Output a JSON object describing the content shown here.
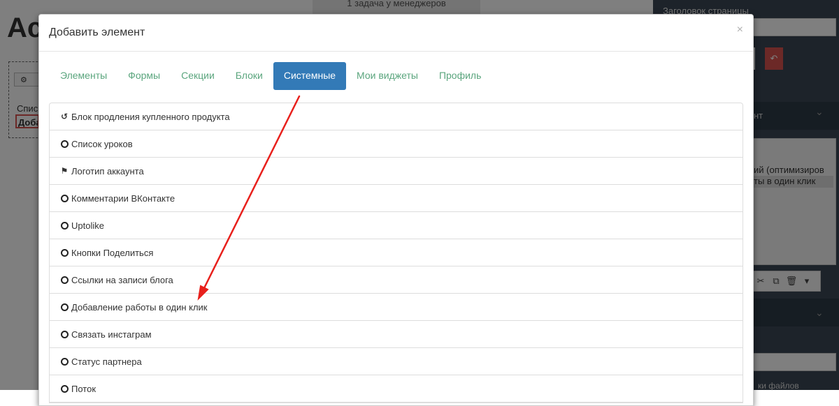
{
  "background": {
    "page_title": "Ac",
    "topbar_text": "1 задача у менеджеров",
    "left_text1": "Спис",
    "left_text2": "Доба",
    "right_label": "Заголовок страницы",
    "right_section_label": "нт",
    "panel_line1": "ий (оптимизиров",
    "panel_line2": "ты в один клик",
    "footer_text": "ки файлов",
    "undo_icon": "↶"
  },
  "modal": {
    "title": "Добавить элемент",
    "close_label": "×",
    "tabs": [
      {
        "label": "Элементы",
        "active": false
      },
      {
        "label": "Формы",
        "active": false
      },
      {
        "label": "Секции",
        "active": false
      },
      {
        "label": "Блоки",
        "active": false
      },
      {
        "label": "Системные",
        "active": true
      },
      {
        "label": "Мои виджеты",
        "active": false
      },
      {
        "label": "Профиль",
        "active": false
      }
    ],
    "items": [
      {
        "label": "Блок продления купленного продукта",
        "icon": "history-icon"
      },
      {
        "label": "Список уроков",
        "icon": "circle-icon"
      },
      {
        "label": "Логотип аккаунта",
        "icon": "flag-icon"
      },
      {
        "label": "Комментарии ВКонтакте",
        "icon": "circle-icon"
      },
      {
        "label": "Uptolike",
        "icon": "circle-icon"
      },
      {
        "label": "Кнопки Поделиться",
        "icon": "circle-icon"
      },
      {
        "label": "Ссылки на записи блога",
        "icon": "circle-icon"
      },
      {
        "label": "Добавление работы в один клик",
        "icon": "circle-icon"
      },
      {
        "label": "Связать инстаграм",
        "icon": "circle-icon"
      },
      {
        "label": "Статус партнера",
        "icon": "circle-icon"
      },
      {
        "label": "Поток",
        "icon": "circle-icon"
      }
    ]
  },
  "annotation": {
    "arrow_color": "#e8201c"
  },
  "colors": {
    "active_tab": "#337ab7",
    "tab_text": "#5aa57d",
    "danger": "#d9534f",
    "sidebar_bg": "#3a4754"
  }
}
